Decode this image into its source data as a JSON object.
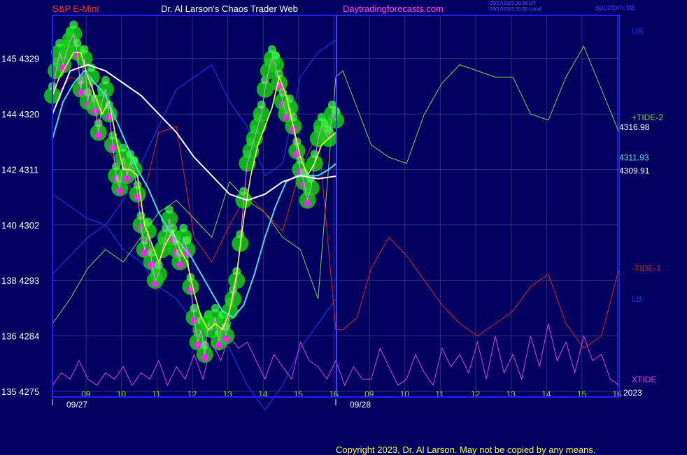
{
  "header": {
    "instrument": "S&P E-Mini",
    "title": "Dr. Al Larson's Chaos Trader Web",
    "site": "Daytradingforecasts.com",
    "timestamp_lines": [
      "09/27/2023 20:20 UT",
      "09/27/2023 15:20 Local"
    ],
    "filename": "spcctom.txt"
  },
  "footer": {
    "copyright": "Copyright 2023, Dr. Al Larson. May not be copied by any means."
  },
  "colors": {
    "background": "#000060",
    "frame": "#2020ff",
    "grid": "#303080",
    "header_red": "#ff3030",
    "header_white": "#ffffff",
    "header_magenta": "#ff40ff",
    "tide_plus": "#7fd84a",
    "tide_minus": "#e02020",
    "bands": "#2030e0",
    "xtide": "#e040e0",
    "ma_fast": "#ffff40",
    "ma_mid": "#40e0e0",
    "ma_slow": "#ffffff",
    "marker_green": "#10d010",
    "marker_magenta": "#ff20ff"
  },
  "chart_data": {
    "type": "line",
    "title": "S&P E-Mini",
    "y_left_labels": [
      {
        "pair": "145",
        "price": 4329
      },
      {
        "pair": "144",
        "price": 4320
      },
      {
        "pair": "142",
        "price": 4311
      },
      {
        "pair": "140",
        "price": 4302
      },
      {
        "pair": "138",
        "price": 4293
      },
      {
        "pair": "136",
        "price": 4284
      },
      {
        "pair": "135",
        "price": 4275
      }
    ],
    "ylim": [
      4275,
      4336
    ],
    "x_hour_labels": [
      "09",
      "10",
      "11",
      "12",
      "13",
      "14",
      "15",
      "16",
      "09",
      "10",
      "11",
      "12",
      "13",
      "14",
      "15",
      "16"
    ],
    "x_date_labels": [
      "09/27",
      "09/28"
    ],
    "x_year": "2023",
    "last_values": {
      "tide2": "4316.98",
      "ma_cyan": "4311.93",
      "ma_white": "4309.91"
    },
    "series_labels": {
      "ub": "UB",
      "tide_plus": "+TIDE-2",
      "tide_minus": "-TIDE-1",
      "lb": "LB",
      "xtide": "XTIDE"
    },
    "series": [
      {
        "name": "price",
        "x": [
          0,
          0.1,
          0.2,
          0.3,
          0.4,
          0.5,
          0.6,
          0.7,
          0.8,
          0.9,
          1,
          1.1,
          1.2,
          1.3,
          1.4,
          1.5,
          1.6,
          1.7,
          1.8,
          1.9,
          2,
          2.1,
          2.2,
          2.3,
          2.4,
          2.5,
          2.6,
          2.7,
          2.8,
          2.9,
          3,
          3.1,
          3.2,
          3.3,
          3.4,
          3.5,
          3.6,
          3.7,
          3.8,
          3.9,
          4,
          4.1,
          4.2,
          4.3,
          4.4,
          4.5,
          4.6,
          4.7,
          4.8,
          4.9,
          5,
          5.1,
          5.2,
          5.3,
          5.4,
          5.5,
          5.6,
          5.7,
          5.8,
          5.9,
          6,
          6.1,
          6.2,
          6.3,
          6.4,
          6.5,
          6.6,
          6.7,
          6.8,
          6.9,
          7,
          7.1,
          7.2,
          7.3,
          7.4,
          7.5,
          7.6,
          7.7,
          7.8,
          7.9,
          8
        ],
        "values": [
          4323,
          4327,
          4330,
          4328,
          4330,
          4332,
          4333,
          4330,
          4324,
          4329,
          4322,
          4326,
          4321,
          4317,
          4322,
          4324,
          4320,
          4315,
          4310,
          4308,
          4313,
          4310,
          4312,
          4311,
          4307,
          4302,
          4298,
          4301,
          4296,
          4293,
          4294,
          4298,
          4300,
          4303,
          4300,
          4298,
          4296,
          4300,
          4298,
          4292,
          4287,
          4283,
          4285,
          4281,
          4286,
          4285,
          4287,
          4283,
          4286,
          4284,
          4288,
          4290,
          4293,
          4299,
          4306,
          4312,
          4314,
          4316,
          4318,
          4320,
          4324,
          4327,
          4329,
          4328,
          4325,
          4322,
          4320,
          4321,
          4318,
          4314,
          4311,
          4309,
          4306,
          4308,
          4312,
          4316,
          4318,
          4317,
          4316,
          4320,
          4319
        ]
      },
      {
        "name": "ma_yellow",
        "x": [
          0,
          0.2,
          0.4,
          0.6,
          0.8,
          1,
          1.2,
          1.4,
          1.6,
          1.8,
          2,
          2.2,
          2.4,
          2.6,
          2.8,
          3,
          3.2,
          3.4,
          3.6,
          3.8,
          4,
          4.2,
          4.4,
          4.6,
          4.8,
          5,
          5.2,
          5.4,
          5.6,
          5.8,
          6,
          6.2,
          6.4,
          6.6,
          6.8,
          7,
          7.2,
          7.4,
          7.6,
          7.8,
          8
        ],
        "values": [
          4323,
          4326,
          4328,
          4330,
          4330,
          4326,
          4323,
          4320,
          4322,
          4316,
          4311,
          4311,
          4310,
          4302,
          4299,
          4296,
          4299,
          4301,
          4298,
          4296,
          4291,
          4287,
          4285,
          4286,
          4285,
          4288,
          4294,
          4303,
          4310,
          4315,
          4318,
          4321,
          4326,
          4323,
          4318,
          4313,
          4310,
          4312,
          4315,
          4316,
          4317
        ]
      },
      {
        "name": "ma_cyan",
        "x": [
          0,
          0.3,
          0.6,
          0.9,
          1.2,
          1.5,
          1.8,
          2.1,
          2.4,
          2.7,
          3,
          3.3,
          3.6,
          3.9,
          4.2,
          4.5,
          4.8,
          5.1,
          5.4,
          5.7,
          6,
          6.3,
          6.6,
          6.9,
          7.2,
          7.5,
          7.8,
          8
        ],
        "values": [
          4316,
          4322,
          4325,
          4327,
          4325,
          4323,
          4319,
          4315,
          4311,
          4308,
          4304,
          4301,
          4299,
          4297,
          4294,
          4291,
          4288,
          4287,
          4289,
          4294,
          4300,
          4305,
          4309,
          4310,
          4310,
          4310,
          4311,
          4311.93
        ]
      },
      {
        "name": "ma_white",
        "x": [
          0,
          0.5,
          1,
          1.5,
          2,
          2.5,
          3,
          3.5,
          4,
          4.5,
          5,
          5.5,
          6,
          6.5,
          7,
          7.5,
          8
        ],
        "values": [
          4320,
          4327,
          4328,
          4327,
          4325,
          4323,
          4320,
          4317,
          4313,
          4310,
          4307,
          4306,
          4307,
          4309,
          4310,
          4309.5,
          4309.91
        ]
      },
      {
        "name": "tide_plus",
        "x": [
          0,
          0.5,
          1,
          1.5,
          2,
          2.5,
          3,
          3.5,
          4,
          4.5,
          5,
          5.5,
          6,
          6.5,
          7,
          7.5,
          8,
          8.2,
          8.6,
          9,
          9.5,
          10,
          10.5,
          11,
          11.5,
          12,
          12.5,
          13,
          13.5,
          14,
          14.5,
          15,
          15.5,
          16
        ],
        "values": [
          4286,
          4290,
          4295,
          4298,
          4296,
          4300,
          4304,
          4306,
          4303,
          4300,
          4309,
          4306,
          4304,
          4300,
          4298,
          4290,
          4326,
          4327,
          4321,
          4315,
          4313,
          4312,
          4320,
          4325,
          4328,
          4327,
          4326,
          4326,
          4320,
          4319,
          4326,
          4331,
          4324,
          4317
        ]
      },
      {
        "name": "tide_minus",
        "x": [
          0,
          0.5,
          1,
          1.5,
          2,
          2.5,
          3,
          3.5,
          4,
          4.5,
          5,
          5.5,
          6,
          6.5,
          7,
          7.5,
          8,
          8.2,
          8.6,
          9,
          9.5,
          10,
          10.5,
          11,
          11.5,
          12,
          12.5,
          13,
          13.5,
          14,
          14.5,
          15,
          15.5,
          16
        ],
        "values": [
          4322,
          4326,
          4325,
          4315,
          4310,
          4305,
          4317,
          4318,
          4300,
          4296,
          4302,
          4307,
          4304,
          4301,
          4311,
          4317,
          4285,
          4285,
          4287,
          4295,
          4300,
          4297,
          4293,
          4289,
          4286,
          4284,
          4286,
          4288,
          4292,
          4294,
          4286,
          4282,
          4284,
          4295
        ]
      },
      {
        "name": "ub",
        "x": [
          0,
          0.5,
          1,
          1.5,
          2,
          2.5,
          3,
          3.5,
          4,
          4.5,
          5,
          5.5,
          6,
          6.5,
          7,
          7.5,
          8
        ],
        "values": [
          4307,
          4305,
          4303,
          4302,
          4306,
          4312,
          4318,
          4324,
          4326,
          4328,
          4322,
          4318,
          4310,
          4312,
          4326,
          4330,
          4332
        ]
      },
      {
        "name": "lb",
        "x": [
          0,
          0.5,
          1,
          1.5,
          2,
          2.5,
          3,
          3.5,
          4,
          4.5,
          5,
          5.5,
          6,
          6.5,
          7,
          7.5,
          8
        ],
        "values": [
          4294,
          4297,
          4300,
          4302,
          4298,
          4296,
          4292,
          4290,
          4286,
          4284,
          4282,
          4276,
          4272,
          4276,
          4282,
          4286,
          4290
        ]
      },
      {
        "name": "xtide",
        "x": [
          0,
          0.25,
          0.5,
          0.75,
          1,
          1.25,
          1.5,
          1.75,
          2,
          2.25,
          2.5,
          2.75,
          3,
          3.25,
          3.5,
          3.75,
          4,
          4.25,
          4.5,
          4.75,
          5,
          5.25,
          5.5,
          5.75,
          6,
          6.25,
          6.5,
          6.75,
          7,
          7.25,
          7.5,
          7.75,
          8,
          8.25,
          8.5,
          8.75,
          9,
          9.25,
          9.5,
          9.75,
          10,
          10.25,
          10.5,
          10.75,
          11,
          11.25,
          11.5,
          11.75,
          12,
          12.25,
          12.5,
          12.75,
          13,
          13.25,
          13.5,
          13.75,
          14,
          14.25,
          14.5,
          14.75,
          15,
          15.25,
          15.5,
          15.75,
          16
        ],
        "values": [
          4276,
          4278,
          4277,
          4280,
          4277,
          4276,
          4278,
          4277,
          4279,
          4276,
          4278,
          4277,
          4280,
          4276,
          4279,
          4277,
          4281,
          4277,
          4283,
          4280,
          4284,
          4282,
          4283,
          4280,
          4277,
          4281,
          4279,
          4277,
          4283,
          4280,
          4279,
          4277,
          4280,
          4276,
          4279,
          4277,
          4277,
          4282,
          4279,
          4276,
          4277,
          4281,
          4278,
          4276,
          4282,
          4279,
          4281,
          4278,
          4283,
          4277,
          4284,
          4278,
          4281,
          4277,
          4284,
          4279,
          4286,
          4280,
          4283,
          4278,
          4284,
          4280,
          4281,
          4277,
          4276
        ]
      }
    ]
  }
}
